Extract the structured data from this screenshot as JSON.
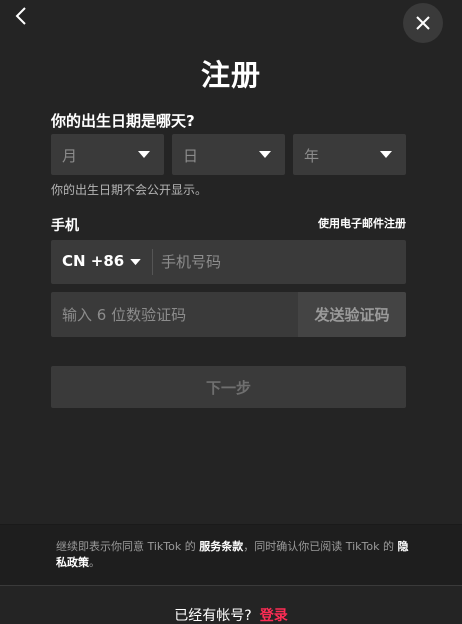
{
  "header": {
    "title": "注册"
  },
  "dob": {
    "label": "你的出生日期是哪天?",
    "month_placeholder": "月",
    "day_placeholder": "日",
    "year_placeholder": "年",
    "hint": "你的出生日期不会公开显示。"
  },
  "phone": {
    "label": "手机",
    "email_link": "使用电子邮件注册",
    "country_code": "CN +86",
    "number_placeholder": "手机号码",
    "code_placeholder": "输入 6 位数验证码",
    "send_code_label": "发送验证码"
  },
  "next_button": "下一步",
  "terms": {
    "prefix": "继续即表示你同意 TikTok 的 ",
    "service_terms": "服务条款",
    "middle": "，同时确认你已阅读 TikTok 的 ",
    "privacy_policy": "隐私政策",
    "suffix": "。"
  },
  "footer": {
    "question": "已经有帐号?",
    "login": "登录"
  },
  "icons": {
    "back": "chevron-left-icon",
    "close": "close-icon",
    "caret": "caret-down-icon"
  },
  "colors": {
    "accent": "#fe2c55",
    "background": "#242424",
    "field": "#3a3a3a"
  }
}
